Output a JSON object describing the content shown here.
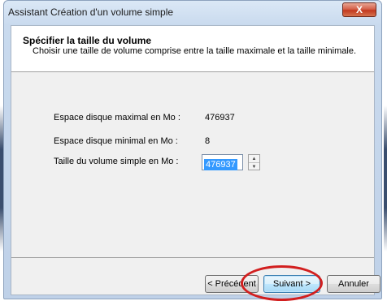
{
  "window": {
    "title": "Assistant Création d'un volume simple",
    "close_label": "X"
  },
  "header": {
    "title": "Spécifier la taille du volume",
    "subtitle": "Choisir une taille de volume comprise entre la taille maximale et la taille minimale."
  },
  "fields": {
    "max": {
      "label": "Espace disque maximal en Mo :",
      "value": "476937"
    },
    "min": {
      "label": "Espace disque minimal en Mo :",
      "value": "8"
    },
    "size": {
      "label": "Taille du volume simple en Mo :",
      "value": "476937"
    }
  },
  "buttons": {
    "back": "< Précédent",
    "next": "Suivant >",
    "cancel": "Annuler"
  },
  "colors": {
    "highlight_ring": "#d21f1f",
    "selection": "#3399ff",
    "close_button": "#c2391f"
  },
  "icons": {
    "spin_up": "▲",
    "spin_down": "▼"
  }
}
